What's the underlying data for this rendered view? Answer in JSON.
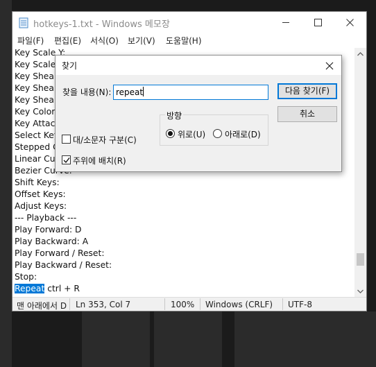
{
  "window": {
    "title": "hotkeys-1.txt - Windows 메모장",
    "icon": "notepad-icon"
  },
  "menu": [
    "파일(F)",
    "편집(E)",
    "서식(O)",
    "보기(V)",
    "도움말(H)"
  ],
  "editor": {
    "lines": [
      "Key Scale Y:",
      "Key Scale",
      "Key Shear",
      "Key Shear",
      "Key Shear",
      "Key Color",
      "Key Attach",
      "Select Key",
      "Stepped C",
      "Linear Cu",
      "Bezier Curve:",
      "Shift Keys:",
      "Offset Keys:",
      "Adjust Keys:",
      "--- Playback ---",
      "Play Forward: D",
      "Play Backward: A",
      "Play Forward / Reset:",
      "Play Backward / Reset:",
      "Stop:"
    ],
    "last_line_selected": "Repeat",
    "last_line_rest": " ctrl + R"
  },
  "statusbar": {
    "message": "맨 아래에서 D",
    "position": "Ln 353, Col 7",
    "zoom": "100%",
    "line_ending": "Windows (CRLF)",
    "encoding": "UTF-8"
  },
  "find_dialog": {
    "title": "찾기",
    "find_label": "찾을 내용(N):",
    "find_value": "repeat",
    "find_next_label": "다음 찾기(F)",
    "cancel_label": "취소",
    "direction_label": "방향",
    "up_label": "위로(U)",
    "down_label": "아래로(D)",
    "direction_selected": "up",
    "match_case_label": "대/소문자 구분(C)",
    "match_case_checked": false,
    "wrap_label": "주위에 배치(R)",
    "wrap_checked": true
  },
  "colors": {
    "selection": "#0078d7",
    "focus_border": "#0078d7"
  }
}
